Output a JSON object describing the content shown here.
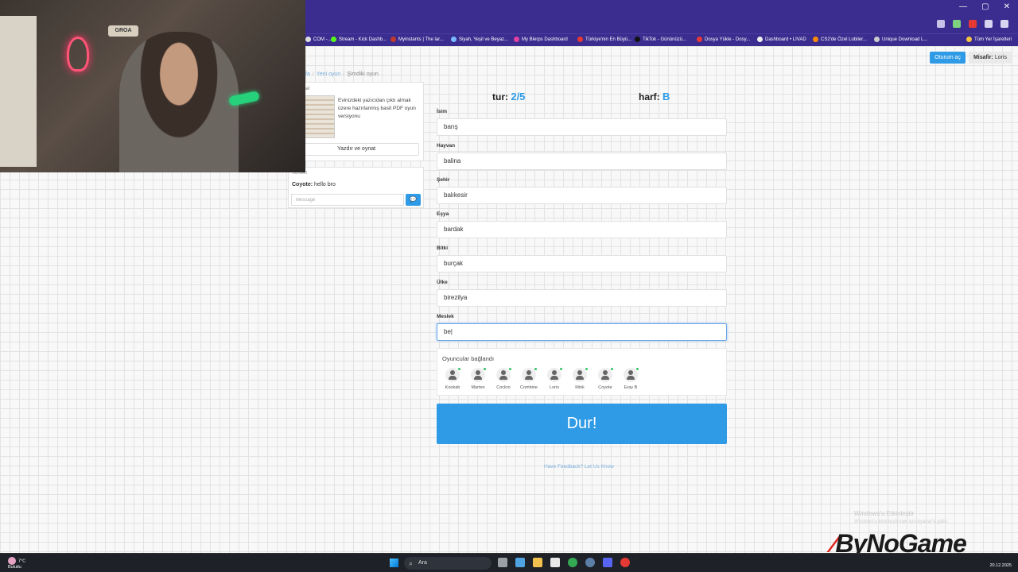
{
  "browser": {
    "bookmarks": [
      {
        "label": "COM -...",
        "color": "#dddddd"
      },
      {
        "label": "Stream - Kick Dashb...",
        "color": "#53fc18"
      },
      {
        "label": "Myinstants | The lar...",
        "color": "#c0392b"
      },
      {
        "label": "Siyah, Yeşil ve Beyaz...",
        "color": "#7ab8ff"
      },
      {
        "label": "My Blerps Dashboard",
        "color": "#e040a0"
      },
      {
        "label": "Türkiye'nin En Büyü...",
        "color": "#e53935"
      },
      {
        "label": "TikTok - Gününüzü...",
        "color": "#111111"
      },
      {
        "label": "Dosya Yükle - Dosy...",
        "color": "#e53935"
      },
      {
        "label": "Dashboard • LIVAD",
        "color": "#eeeeee"
      },
      {
        "label": "CS2'de Özel Lobiler...",
        "color": "#ff8a00"
      },
      {
        "label": "Unique Download L...",
        "color": "#cccccc"
      },
      {
        "label": "Tüm Yer İşaretleri",
        "color": "#f5c542"
      }
    ]
  },
  "header": {
    "login_label": "Oturum aç",
    "guest_prefix": "Misafir:",
    "guest_name": "Loris"
  },
  "breadcrumb": {
    "first": "fa",
    "second": "Yeni oyun",
    "current": "Şimdiki oyun"
  },
  "print_card": {
    "title": "ve oyna!",
    "description": "Evinizdeki yazıcıdan çıktı almak üzere hazırlanmış basit PDF oyun versiyonu",
    "button": "Yazdır ve oynat"
  },
  "chat": {
    "header": "Sohbet",
    "message_author": "Coyote:",
    "message_text": "hello bro",
    "input_placeholder": "Message",
    "send_icon": "💬"
  },
  "webcam": {
    "sign_text": "GROA"
  },
  "game": {
    "round_label": "tur:",
    "round_value": "2/5",
    "letter_label": "harf:",
    "letter_value": "B",
    "fields": [
      {
        "label": "İsim",
        "value": "barış"
      },
      {
        "label": "Hayvan",
        "value": "balina"
      },
      {
        "label": "Şehir",
        "value": "balıkesir"
      },
      {
        "label": "Eşya",
        "value": "bardak"
      },
      {
        "label": "Bitki",
        "value": "burçak"
      },
      {
        "label": "Ülke",
        "value": "birezilya"
      },
      {
        "label": "Meslek",
        "value": "be|"
      }
    ],
    "players_title": "Oyuncular bağlandı",
    "players": [
      "Kookab",
      "Marten",
      "Cockro",
      "Combine",
      "Loris",
      "Mink",
      "Coyote",
      "Eray B"
    ],
    "stop_button": "Dur!",
    "feedback_link": "Have Feedback? Let Us Know"
  },
  "watermark": {
    "line1": "Windows'u Etkinleştir",
    "line2": "Windows'u etkinleştirmek için Ayarlar'a gidin.",
    "logo": "ByNoGame"
  },
  "taskbar": {
    "temp": "7°C",
    "weather": "Bulutlu",
    "search_placeholder": "Ara",
    "date": "20.12.2025"
  }
}
